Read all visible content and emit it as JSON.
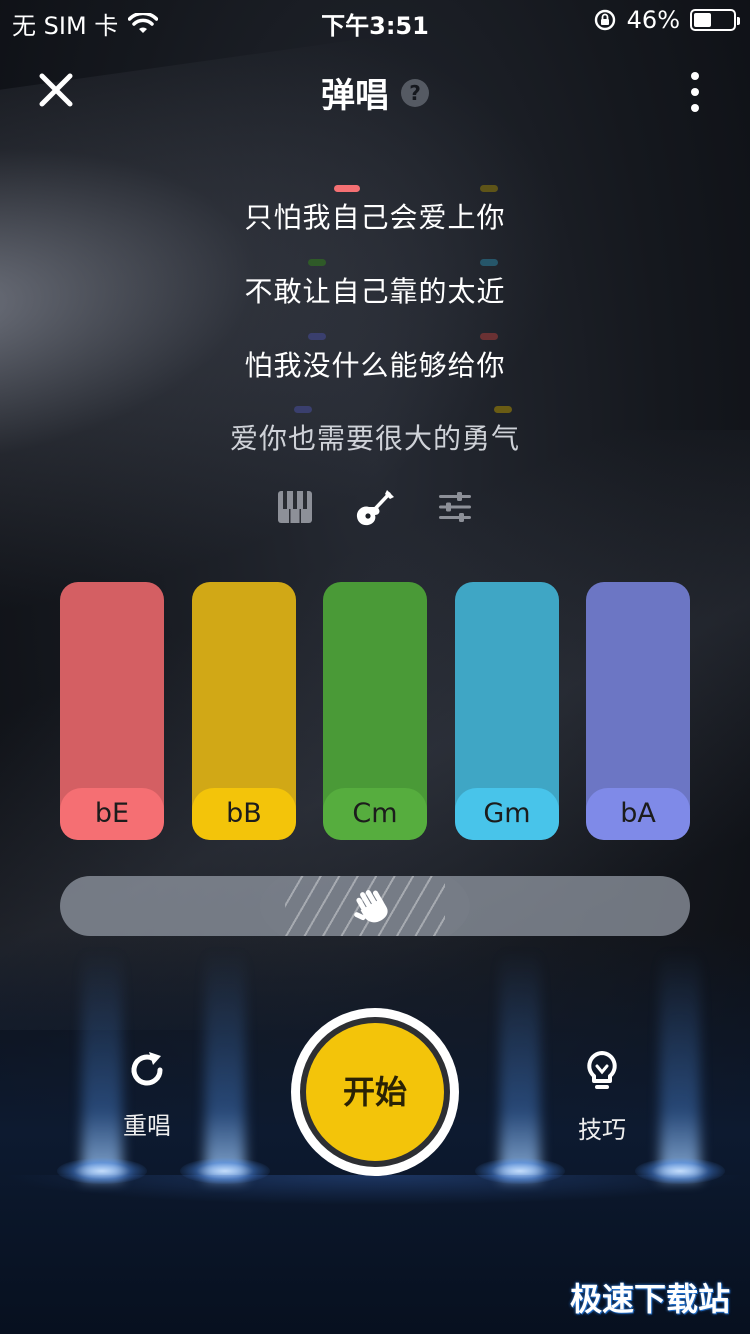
{
  "status_bar": {
    "carrier": "无 SIM 卡",
    "time": "下午3:51",
    "battery": "46%",
    "battery_level": 0.46
  },
  "header": {
    "title": "弹唱",
    "help": "?"
  },
  "lyrics": [
    "只怕我自己会爱上你",
    "不敢让自己靠的太近",
    "怕我没什么能够给你",
    "爱你也需要很大的勇气"
  ],
  "instruments": [
    "piano-icon",
    "guitar-icon",
    "sliders-icon"
  ],
  "chords": [
    {
      "label": "bE",
      "color": "#d45f63",
      "label_color": "#f56f73"
    },
    {
      "label": "bB",
      "color": "#d1a816",
      "label_color": "#f3c40a"
    },
    {
      "label": "Cm",
      "color": "#4a9a37",
      "label_color": "#56ad3e"
    },
    {
      "label": "Gm",
      "color": "#3fa6c5",
      "label_color": "#48c4ea"
    },
    {
      "label": "bA",
      "color": "#6c76c4",
      "label_color": "#7f8ae8"
    }
  ],
  "controls": {
    "restart": "重唱",
    "start": "开始",
    "tips": "技巧"
  },
  "watermark": "极速下载站"
}
